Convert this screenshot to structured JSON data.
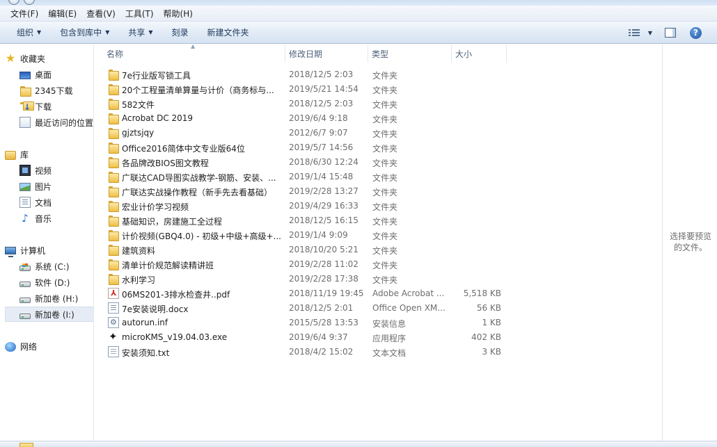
{
  "menubar": {
    "items": [
      "文件(F)",
      "编辑(E)",
      "查看(V)",
      "工具(T)",
      "帮助(H)"
    ]
  },
  "toolbar": {
    "organize": "组织",
    "include_in_library": "包含到库中",
    "share": "共享",
    "burn": "刻录",
    "new_folder": "新建文件夹"
  },
  "nav": {
    "favorites": {
      "label": "收藏夹",
      "items": [
        "桌面",
        "2345下载",
        "下载",
        "最近访问的位置"
      ]
    },
    "libraries": {
      "label": "库",
      "items": [
        "视频",
        "图片",
        "文档",
        "音乐"
      ]
    },
    "computer": {
      "label": "计算机",
      "items": [
        "系统 (C:)",
        "软件 (D:)",
        "新加卷 (H:)",
        "新加卷 (I:)"
      ]
    },
    "network": {
      "label": "网络"
    }
  },
  "columns": {
    "name": "名称",
    "date": "修改日期",
    "type": "类型",
    "size": "大小"
  },
  "files": [
    {
      "name": "7e行业版写锁工具",
      "date": "2018/12/5 2:03",
      "type": "文件夹",
      "size": "",
      "icon": "folder-icon"
    },
    {
      "name": "20个工程量清单算量与计价（商务标与...",
      "date": "2019/5/21 14:54",
      "type": "文件夹",
      "size": "",
      "icon": "folder-icon"
    },
    {
      "name": "582文件",
      "date": "2018/12/5 2:03",
      "type": "文件夹",
      "size": "",
      "icon": "folder-icon"
    },
    {
      "name": "Acrobat DC 2019",
      "date": "2019/6/4 9:18",
      "type": "文件夹",
      "size": "",
      "icon": "folder-icon"
    },
    {
      "name": "gjztsjqy",
      "date": "2012/6/7 9:07",
      "type": "文件夹",
      "size": "",
      "icon": "folder-icon"
    },
    {
      "name": "Office2016简体中文专业版64位",
      "date": "2019/5/7 14:56",
      "type": "文件夹",
      "size": "",
      "icon": "folder-icon"
    },
    {
      "name": "各品牌改BIOS图文教程",
      "date": "2018/6/30 12:24",
      "type": "文件夹",
      "size": "",
      "icon": "folder-icon"
    },
    {
      "name": "广联达CAD导图实战教学-钢筋、安装、...",
      "date": "2019/1/4 15:48",
      "type": "文件夹",
      "size": "",
      "icon": "folder-icon"
    },
    {
      "name": "广联达实战操作教程（新手先去看基础）",
      "date": "2019/2/28 13:27",
      "type": "文件夹",
      "size": "",
      "icon": "folder-icon"
    },
    {
      "name": "宏业计价学习视频",
      "date": "2019/4/29 16:33",
      "type": "文件夹",
      "size": "",
      "icon": "folder-icon"
    },
    {
      "name": "基础知识，房建施工全过程",
      "date": "2018/12/5 16:15",
      "type": "文件夹",
      "size": "",
      "icon": "folder-icon"
    },
    {
      "name": "计价视频(GBQ4.0) - 初级+中级+高级+...",
      "date": "2019/1/4 9:09",
      "type": "文件夹",
      "size": "",
      "icon": "folder-icon"
    },
    {
      "name": "建筑资料",
      "date": "2018/10/20 5:21",
      "type": "文件夹",
      "size": "",
      "icon": "folder-icon"
    },
    {
      "name": "清单计价规范解读精讲班",
      "date": "2019/2/28 11:02",
      "type": "文件夹",
      "size": "",
      "icon": "folder-icon"
    },
    {
      "name": "水利学习",
      "date": "2019/2/28 17:38",
      "type": "文件夹",
      "size": "",
      "icon": "folder-icon"
    },
    {
      "name": "06MS201-3排水检查井..pdf",
      "date": "2018/11/19 19:45",
      "type": "Adobe Acrobat ...",
      "size": "5,518 KB",
      "icon": "pdf-file-icon"
    },
    {
      "name": "7e安装说明.docx",
      "date": "2018/12/5 2:01",
      "type": "Office Open XM...",
      "size": "56 KB",
      "icon": "word-document-icon"
    },
    {
      "name": "autorun.inf",
      "date": "2015/5/28 13:53",
      "type": "安装信息",
      "size": "1 KB",
      "icon": "setup-info-icon"
    },
    {
      "name": "microKMS_v19.04.03.exe",
      "date": "2019/6/4 9:37",
      "type": "应用程序",
      "size": "402 KB",
      "icon": "application-icon"
    },
    {
      "name": "安装须知.txt",
      "date": "2018/4/2 15:02",
      "type": "文本文档",
      "size": "3 KB",
      "icon": "text-file-icon"
    }
  ],
  "preview": {
    "text": "选择要预览的文件。"
  }
}
